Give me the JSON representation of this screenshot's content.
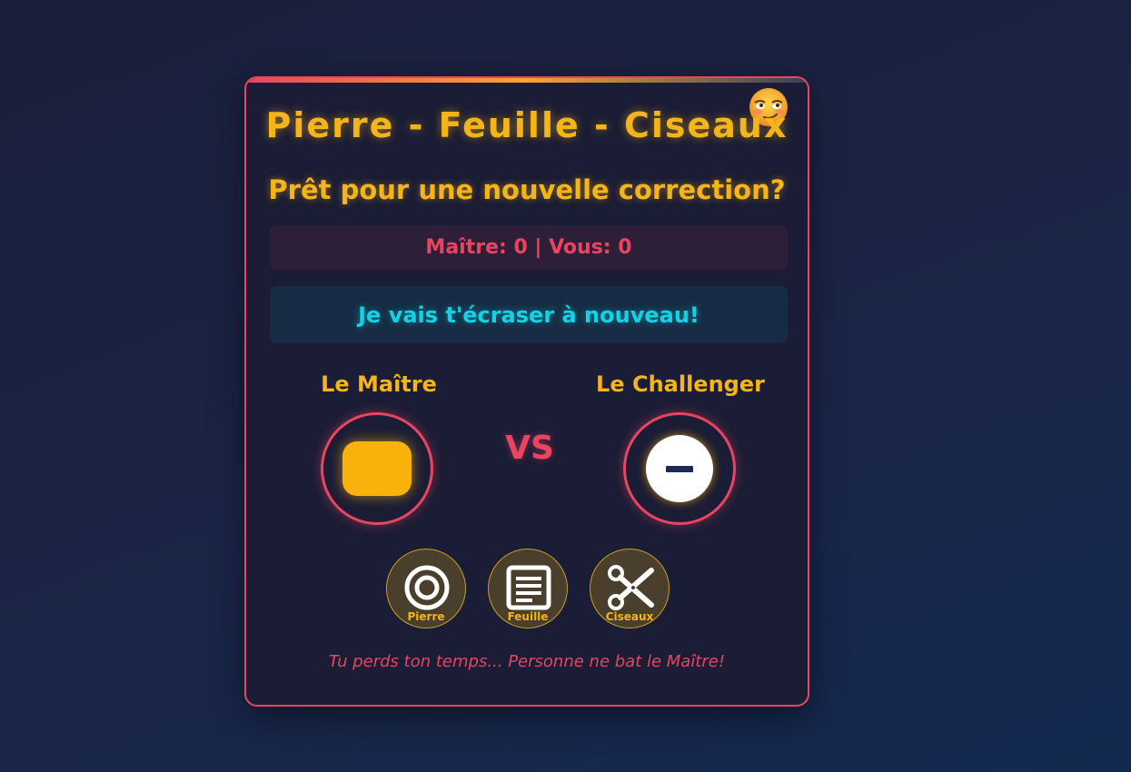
{
  "game": {
    "title": "Pierre - Feuille - Ciseaux",
    "subtitle": "Prêt pour une nouvelle correction?",
    "score_text": "Maître: 0 | Vous: 0",
    "message": "Je vais t'écraser à nouveau!",
    "vs_label": "VS",
    "taunt": "Tu perds ton temps... Personne ne bat le Maître!",
    "emoji_icon": "smirking-face-icon"
  },
  "players": {
    "master": {
      "label": "Le Maître",
      "token_icon": "rounded-square-token-icon"
    },
    "challenger": {
      "label": "Le Challenger",
      "token_icon": "minus-circle-icon"
    }
  },
  "choices": [
    {
      "label": "Pierre",
      "icon": "target-icon"
    },
    {
      "label": "Feuille",
      "icon": "document-icon"
    },
    {
      "label": "Ciseaux",
      "icon": "scissors-icon"
    }
  ],
  "colors": {
    "accent_pink": "#e94560",
    "accent_gold": "#f5b417",
    "accent_cyan": "#14d2e6",
    "card_bg": "#1b1c35"
  }
}
